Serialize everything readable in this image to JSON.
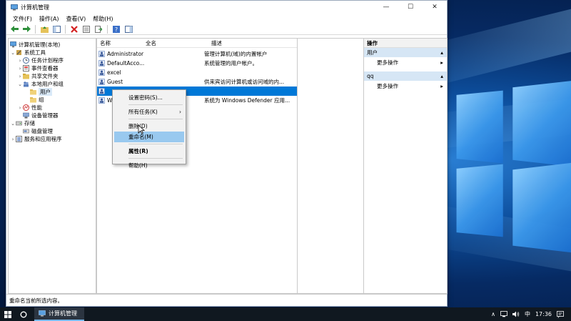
{
  "window": {
    "title": "计算机管理",
    "controls": {
      "minimize": "—",
      "maximize": "☐",
      "close": "✕"
    }
  },
  "menubar": [
    "文件(F)",
    "操作(A)",
    "查看(V)",
    "帮助(H)"
  ],
  "tree": {
    "root": "计算机管理(本地)",
    "system_tools": "系统工具",
    "task_scheduler": "任务计划程序",
    "event_viewer": "事件查看器",
    "shared_folders": "共享文件夹",
    "local_users_groups": "本地用户和组",
    "users": "用户",
    "groups": "组",
    "performance": "性能",
    "device_manager": "设备管理器",
    "storage": "存储",
    "disk_management": "磁盘管理",
    "services_apps": "服务和应用程序"
  },
  "list": {
    "headers": {
      "name": "名称",
      "full_name": "全名",
      "description": "描述"
    },
    "rows": [
      {
        "name": "Administrator",
        "description": "管理计算机(域)的内置帐户"
      },
      {
        "name": "DefaultAcco...",
        "description": "系统管理的用户帐户。"
      },
      {
        "name": "excel",
        "description": ""
      },
      {
        "name": "Guest",
        "description": "供来宾访问计算机或访问域的内..."
      },
      {
        "name": "",
        "description": ""
      },
      {
        "name": "W",
        "description": "系统为 Windows Defender 应用..."
      }
    ]
  },
  "context_menu": {
    "set_password": "设置密码(S)...",
    "all_tasks": "所有任务(K)",
    "delete": "删除(D)",
    "rename": "重命名(M)",
    "properties": "属性(R)",
    "help": "帮助(H)"
  },
  "actions": {
    "header": "操作",
    "section1": "用户",
    "section1_more": "更多操作",
    "section2": "qq",
    "section2_more": "更多操作"
  },
  "statusbar": {
    "text": "重命名当前所选内容。"
  },
  "taskbar": {
    "task_label": "计算机管理",
    "ime": "中",
    "time": "17:36"
  }
}
